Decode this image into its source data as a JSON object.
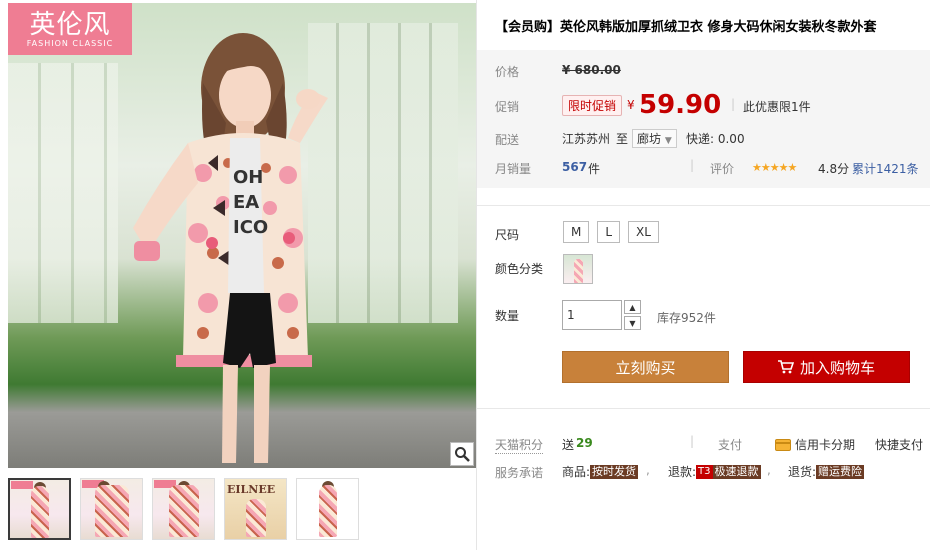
{
  "gallery": {
    "logo_cn": "英伦风",
    "logo_en": "FASHION CLASSIC",
    "thumb_text": "EILNEE"
  },
  "product": {
    "title": "【会员购】英伦风韩版加厚抓绒卫衣 修身大码休闲女装秋冬款外套"
  },
  "price": {
    "label": "价格",
    "original": "¥ 680.00",
    "promo_label": "促销",
    "promo_tag": "限时促销",
    "currency": "¥",
    "current": "59.90",
    "limit_note": "此优惠限1件"
  },
  "shipping": {
    "label": "配送",
    "from": "江苏苏州",
    "to_word": "至",
    "destination": "廊坊",
    "fee": "快递: 0.00"
  },
  "sales": {
    "label": "月销量",
    "count": "567",
    "unit": "件",
    "rating_label": "评价",
    "stars": "★★★★★",
    "score": "4.8分",
    "reviews": "累计1421条"
  },
  "sku": {
    "size_label": "尺码",
    "sizes": [
      "M",
      "L",
      "XL"
    ],
    "color_label": "颜色分类",
    "qty_label": "数量",
    "qty_value": "1",
    "stock": "库存952件"
  },
  "actions": {
    "buy": "立刻购买",
    "cart": "加入购物车"
  },
  "extras": {
    "points_label": "天猫积分",
    "points_prefix": "送",
    "points": "29",
    "pay_label": "支付",
    "credit": "信用卡分期",
    "quick_pay": "快捷支付",
    "service_label": "服务承诺",
    "goods_prefix": "商品:",
    "goods_badge": "按时发货",
    "refund_prefix": "退款:",
    "t3": "T3",
    "refund_badge": "极速退款",
    "return_prefix": "退货:",
    "return_badge": "赠运费险"
  },
  "colors": {
    "price_red": "#c40000",
    "buy_orange": "#c8813a",
    "logo_pink": "#ef7d93"
  }
}
